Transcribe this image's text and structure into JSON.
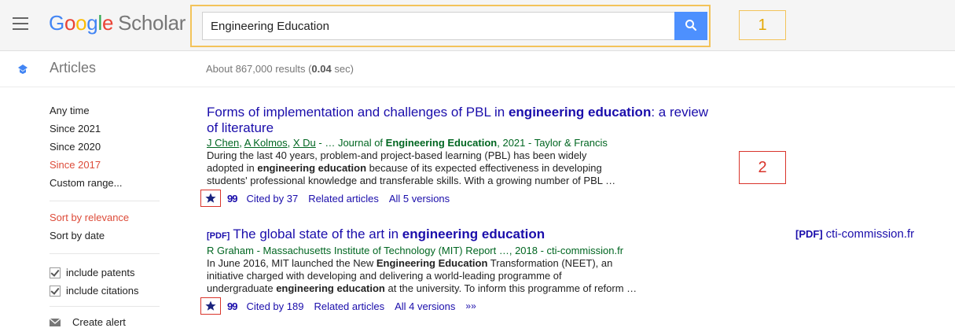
{
  "header": {
    "logo_google": [
      "G",
      "o",
      "o",
      "g",
      "l",
      "e"
    ],
    "logo_scholar": "Scholar",
    "search_query": "Engineering Education",
    "callout_1": "1",
    "callout_2": "2"
  },
  "articles": {
    "label": "Articles",
    "result_count_prefix": "About 867,000 results (",
    "result_count_time": "0.04",
    "result_count_suffix": " sec)"
  },
  "sidebar": {
    "time_filters": [
      "Any time",
      "Since 2021",
      "Since 2020",
      "Since 2017",
      "Custom range..."
    ],
    "active_time_filter": "Since 2017",
    "sort": [
      "Sort by relevance",
      "Sort by date"
    ],
    "active_sort": "Sort by relevance",
    "checks": [
      "include patents",
      "include citations"
    ],
    "create_alert": "Create alert"
  },
  "results": [
    {
      "title_pre": "Forms of implementation and challenges of PBL in ",
      "title_bold": "engineering education",
      "title_post": ": a review of literature",
      "author_1": "J Chen",
      "author_2": "A Kolmos",
      "author_3": "X Du",
      "author_rest_pre": " - … Journal of ",
      "author_rest_bold": "Engineering Education",
      "author_rest_post": ", 2021 - Taylor & Francis",
      "snippet_1": "During the last 40 years, problem-and project-based learning (PBL) has been widely",
      "snippet_2_pre": "adopted in ",
      "snippet_2_bold": "engineering education",
      "snippet_2_post": " because of its expected effectiveness in developing",
      "snippet_3": "students' professional knowledge and transferable skills. With a growing number of PBL …",
      "cited_by": "Cited by 37",
      "related": "Related articles",
      "versions": "All 5 versions"
    },
    {
      "pdf_tag": "[PDF]",
      "title_pre": "The global state of the art in ",
      "title_bold": "engineering education",
      "authors_line": "R Graham - Massachusetts Institute of Technology (MIT) Report …, 2018 - cti-commission.fr",
      "snippet_1_pre": "In June 2016, MIT launched the New ",
      "snippet_1_bold": "Engineering Education",
      "snippet_1_post": " Transformation (NEET), an",
      "snippet_2": "initiative charged with developing and delivering a world-leading programme of",
      "snippet_3_pre": "undergraduate ",
      "snippet_3_bold": "engineering education",
      "snippet_3_post": " at the university. To inform this programme of reform …",
      "cited_by": "Cited by 189",
      "related": "Related articles",
      "versions": "All 4 versions",
      "side_pdf_tag": "[PDF]",
      "side_pdf_domain": "cti-commission.fr"
    }
  ]
}
